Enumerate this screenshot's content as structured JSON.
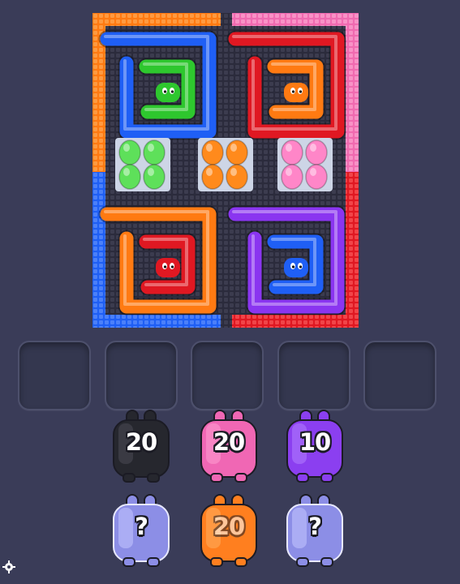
{
  "board": {
    "colors": {
      "frame": "#2b2b3c",
      "tray": "#cdd5e6",
      "orange": "#ff7a12",
      "pink": "#f06ab0",
      "blue": "#1f5ff5",
      "red": "#e01822",
      "green": "#2ec72e",
      "purple": "#8a35f0",
      "egg_green": "#5ee05a",
      "egg_orange": "#ff8a1c",
      "egg_pink": "#ff86c8"
    },
    "snakes": [
      {
        "name": "top-left",
        "outer_color": "blue",
        "inner_color": "green"
      },
      {
        "name": "top-right",
        "outer_color": "red",
        "inner_color": "orange"
      },
      {
        "name": "bottom-left",
        "outer_color": "orange",
        "inner_color": "red"
      },
      {
        "name": "bottom-right",
        "outer_color": "purple",
        "inner_color": "blue"
      }
    ],
    "egg_trays": [
      "egg_green",
      "egg_orange",
      "egg_pink"
    ]
  },
  "slots": {
    "count": 5
  },
  "blocks": [
    {
      "label": "20",
      "color": "#26272e",
      "highlight": "#4a4b55",
      "hidden": false
    },
    {
      "label": "20",
      "color": "#f067b4",
      "highlight": "#ff9fd2",
      "hidden": false
    },
    {
      "label": "10",
      "color": "#8b3ff0",
      "highlight": "#b27dff",
      "hidden": false
    },
    {
      "label": "?",
      "color": "#8c8ee6",
      "highlight": "#c4c6ff",
      "hidden": true
    },
    {
      "label": "20",
      "color": "#ff7f1f",
      "highlight": "#ffae5e",
      "hidden": false
    },
    {
      "label": "?",
      "color": "#8c8ee6",
      "highlight": "#c4c6ff",
      "hidden": true
    }
  ],
  "icons": {
    "settings": "gear-icon"
  }
}
